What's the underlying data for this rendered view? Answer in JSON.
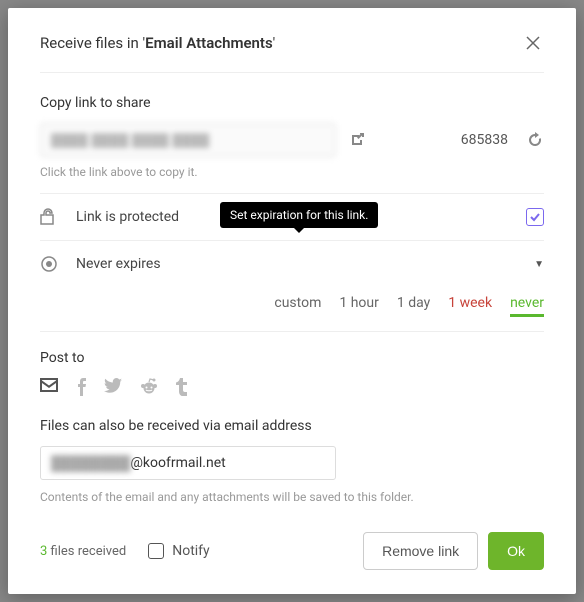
{
  "title_prefix": "Receive files in '",
  "folder_name": "Email Attachments",
  "title_suffix": "'",
  "copy_label": "Copy link to share",
  "link_value": "████ ████ ████ ████",
  "count": "685838",
  "hint": "Click the link above to copy it.",
  "protected_label": "Link is protected",
  "tooltip": "Set expiration for this link.",
  "expires_label": "Never expires",
  "exp": {
    "custom": "custom",
    "hour": "1 hour",
    "day": "1 day",
    "week": "1 week",
    "never": "never"
  },
  "post_label": "Post to",
  "email_label": "Files can also be received via email address",
  "email_user": "████████",
  "email_domain": "@koofrmail.net",
  "email_hint": "Contents of the email and any attachments will be saved to this folder.",
  "received_n": "3",
  "received_txt": " files received",
  "notify": "Notify",
  "remove": "Remove link",
  "ok": "Ok"
}
